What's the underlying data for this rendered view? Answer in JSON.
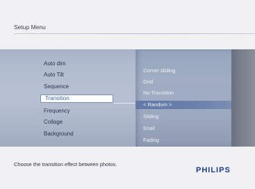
{
  "header": {
    "title": "Setup Menu"
  },
  "menu": {
    "items": [
      {
        "label": "Auto dim",
        "selected": false
      },
      {
        "label": "Auto Tilt",
        "selected": false
      },
      {
        "label": "Sequence",
        "selected": false
      },
      {
        "label": "Transition",
        "selected": true
      },
      {
        "label": "Frequency",
        "selected": false
      },
      {
        "label": "Collage",
        "selected": false
      },
      {
        "label": "Background",
        "selected": false
      }
    ]
  },
  "submenu": {
    "items": [
      {
        "label": "Corner sliding",
        "selected": false
      },
      {
        "label": "Grid",
        "selected": false
      },
      {
        "label": "No Transition",
        "selected": false
      },
      {
        "label": "< Random >",
        "selected": true
      },
      {
        "label": "Sliding",
        "selected": false
      },
      {
        "label": "Snail",
        "selected": false
      },
      {
        "label": "Fading",
        "selected": false
      }
    ]
  },
  "footer": {
    "hint": "Choose the transition effect between photos.",
    "brand": "PHILIPS"
  },
  "colors": {
    "selection_text": "#3c63a8",
    "submenu_highlight": "#6279a7",
    "brand": "#1c3a88"
  }
}
